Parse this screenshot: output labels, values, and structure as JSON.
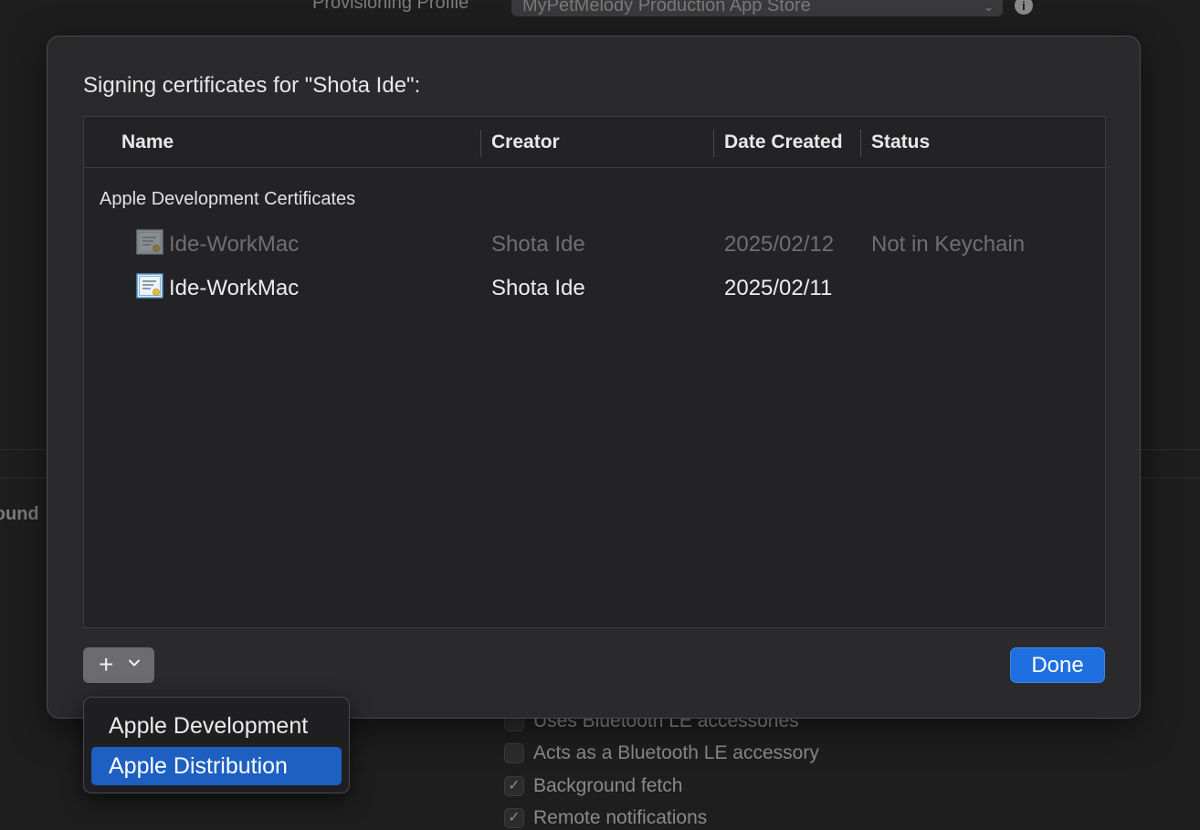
{
  "background": {
    "provisioning_label": "Provisioning Profile",
    "provisioning_value": "MyPetMelody Production App Store",
    "section_label": "round",
    "capabilities": [
      {
        "label": "Uses Bluetooth LE accessories",
        "checked": false
      },
      {
        "label": "Acts as a Bluetooth LE accessory",
        "checked": false
      },
      {
        "label": "Background fetch",
        "checked": true
      },
      {
        "label": "Remote notifications",
        "checked": true
      }
    ]
  },
  "sheet": {
    "title": "Signing certificates for \"Shota Ide\":",
    "columns": {
      "name": "Name",
      "creator": "Creator",
      "date_created": "Date Created",
      "status": "Status"
    },
    "group_label": "Apple Development Certificates",
    "rows": [
      {
        "name": "Ide-WorkMac",
        "creator": "Shota Ide",
        "date": "2025/02/12",
        "status": "Not in Keychain",
        "dimmed": true
      },
      {
        "name": "Ide-WorkMac",
        "creator": "Shota Ide",
        "date": "2025/02/11",
        "status": "",
        "dimmed": false
      }
    ],
    "add_button_icon": "plus-icon",
    "done_label": "Done"
  },
  "menu": {
    "items": [
      {
        "label": "Apple Development",
        "selected": false
      },
      {
        "label": "Apple Distribution",
        "selected": true
      }
    ]
  },
  "colors": {
    "accent": "#1f6fe0",
    "selection": "#1e5fc2",
    "sheet_bg": "#2a2a2d"
  }
}
